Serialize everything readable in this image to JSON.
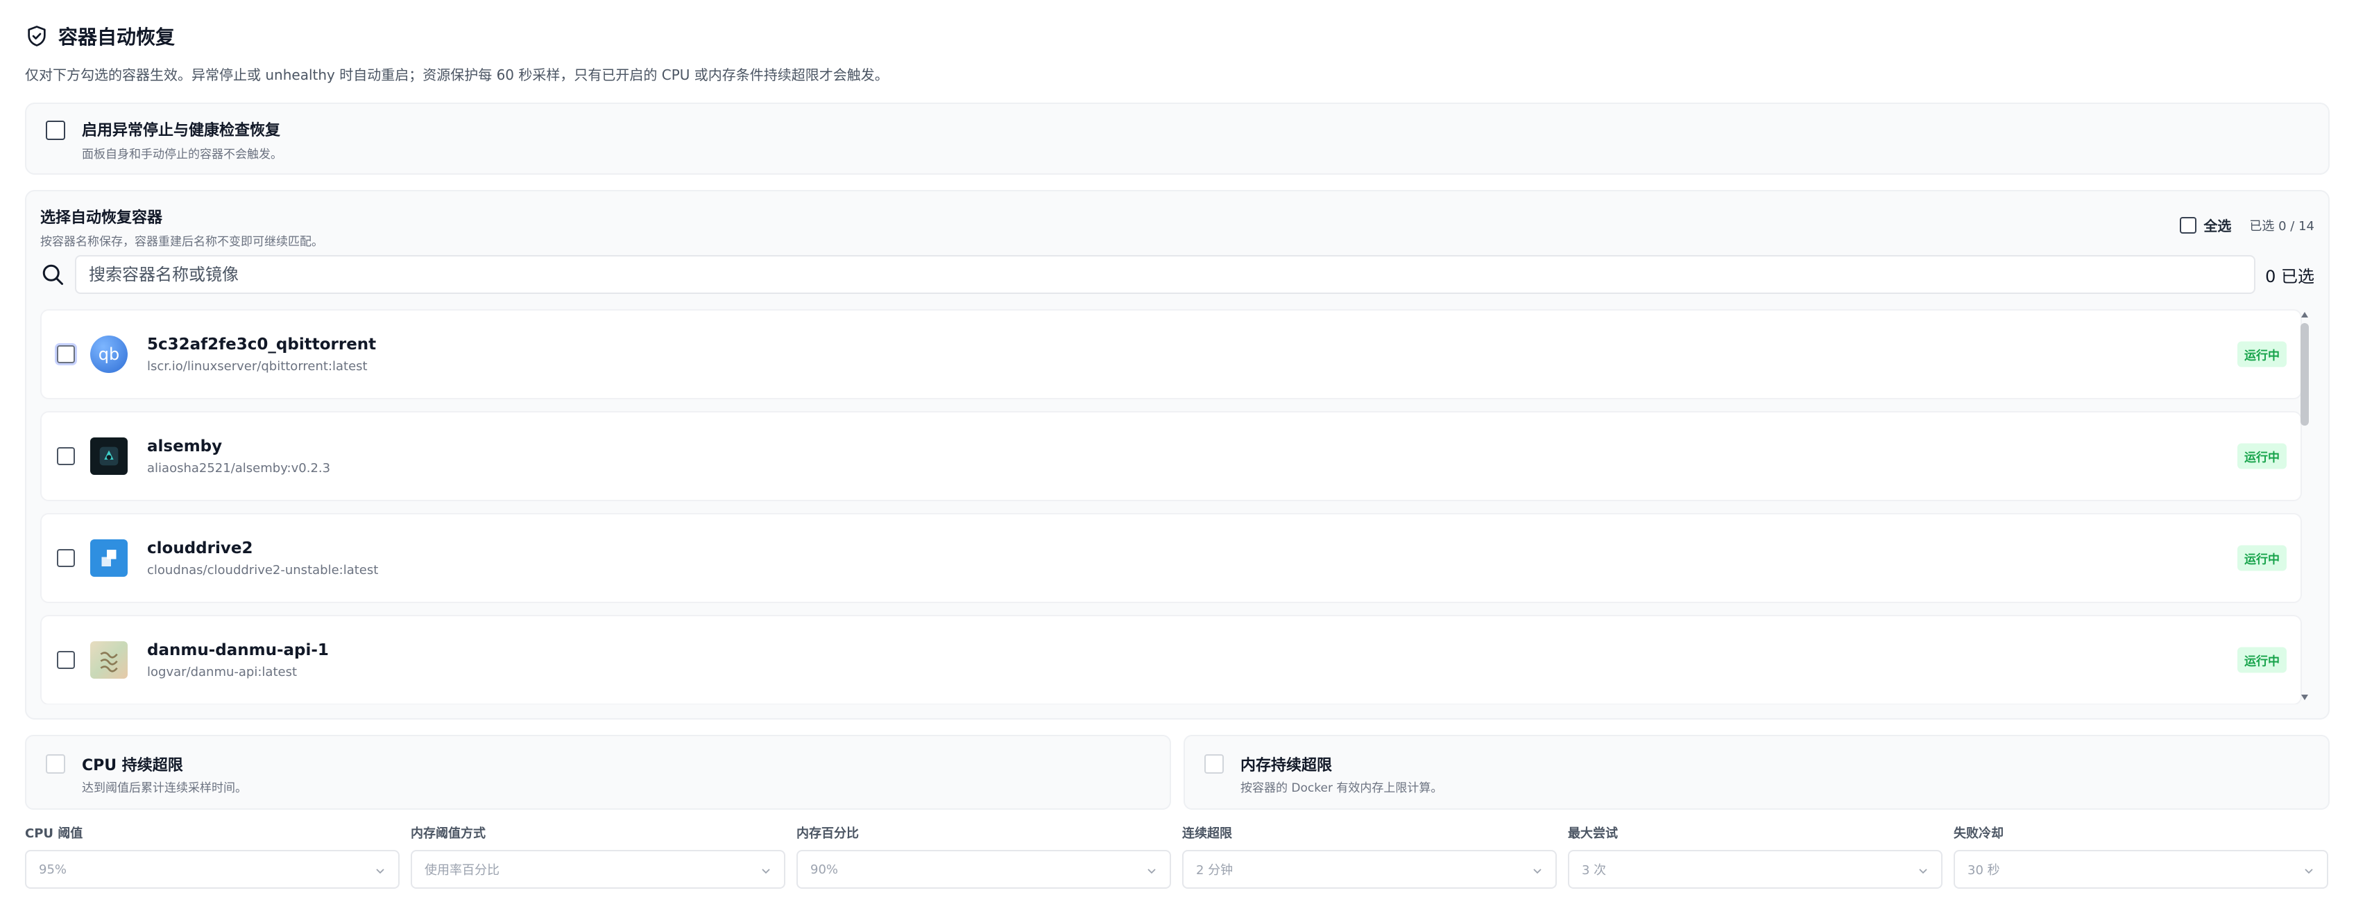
{
  "header": {
    "title": "容器自动恢复",
    "description": "仅对下方勾选的容器生效。异常停止或 unhealthy 时自动重启；资源保护每 60 秒采样，只有已开启的 CPU 或内存条件持续超限才会触发。"
  },
  "health_option": {
    "title": "启用异常停止与健康检查恢复",
    "subtitle": "面板自身和手动停止的容器不会触发。"
  },
  "selector": {
    "title": "选择自动恢复容器",
    "subtitle": "按容器名称保存，容器重建后名称不变即可继续匹配。",
    "select_all_label": "全选",
    "selected_count": "已选 0 / 14",
    "search_placeholder": "搜索容器名称或镜像",
    "search_count": "0 已选"
  },
  "containers": [
    {
      "name": "5c32af2fe3c0_qbittorrent",
      "image": "lscr.io/linuxserver/qbittorrent:latest",
      "status": "运行中",
      "icon": "qbittorrent-icon",
      "icon_text": "qb"
    },
    {
      "name": "alsemby",
      "image": "aliaosha2521/alsemby:v0.2.3",
      "status": "运行中",
      "icon": "alsemby-icon"
    },
    {
      "name": "clouddrive2",
      "image": "cloudnas/clouddrive2-unstable:latest",
      "status": "运行中",
      "icon": "clouddrive2-icon"
    },
    {
      "name": "danmu-danmu-api-1",
      "image": "logvar/danmu-api:latest",
      "status": "运行中",
      "icon": "danmu-api-icon"
    }
  ],
  "limits": {
    "cpu": {
      "title": "CPU 持续超限",
      "subtitle": "达到阈值后累计连续采样时间。"
    },
    "memory": {
      "title": "内存持续超限",
      "subtitle": "按容器的 Docker 有效内存上限计算。"
    }
  },
  "fields": [
    {
      "label": "CPU 阈值",
      "value": "95%"
    },
    {
      "label": "内存阈值方式",
      "value": "使用率百分比"
    },
    {
      "label": "内存百分比",
      "value": "90%"
    },
    {
      "label": "连续超限",
      "value": "2 分钟"
    },
    {
      "label": "最大尝试",
      "value": "3 次"
    },
    {
      "label": "失败冷却",
      "value": "30 秒"
    }
  ],
  "colors": {
    "accent_green": "#16a34a",
    "badge_bg": "#dcfce7",
    "qbittorrent_blue": "#3b82f6",
    "clouddrive_blue": "#2f8fe0"
  }
}
